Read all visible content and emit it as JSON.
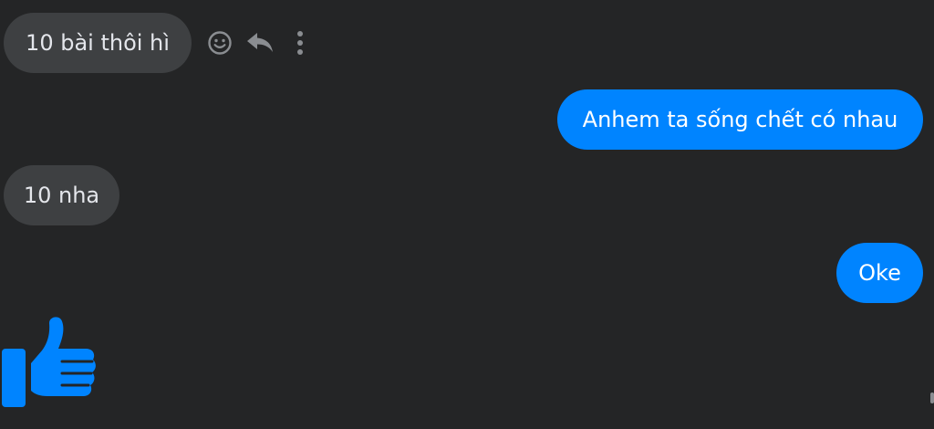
{
  "conversation": {
    "messages": [
      {
        "direction": "incoming",
        "text": "10 bài thôi hì"
      },
      {
        "direction": "outgoing",
        "text": "Anhem ta sống chết có nhau"
      },
      {
        "direction": "incoming",
        "text": "10 nha"
      },
      {
        "direction": "outgoing",
        "text": "Oke"
      }
    ],
    "hover_actions": [
      {
        "icon": "smiley-face-icon"
      },
      {
        "icon": "reply-arrow-icon"
      },
      {
        "icon": "more-vertical-icon"
      }
    ],
    "sticker": {
      "icon": "thumbs-up-icon",
      "color": "#0084ff"
    }
  },
  "colors": {
    "background": "#242526",
    "incoming_bubble": "#3e4042",
    "outgoing_bubble": "#0084ff",
    "icon_gray": "#8a8d91"
  }
}
